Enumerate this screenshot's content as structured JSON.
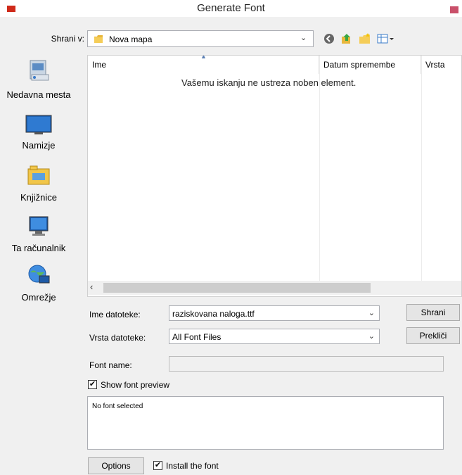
{
  "window": {
    "title": "Generate Font"
  },
  "lookin": {
    "label": "Shrani v:",
    "value": "Nova mapa"
  },
  "places": [
    {
      "label": "Nedavna mesta"
    },
    {
      "label": "Namizje"
    },
    {
      "label": "Knjižnice"
    },
    {
      "label": "Ta računalnik"
    },
    {
      "label": "Omrežje"
    }
  ],
  "filelist": {
    "columns": [
      "Ime",
      "Datum spremembe",
      "Vrsta"
    ],
    "empty_message": "Vašemu iskanju ne ustreza noben element."
  },
  "form": {
    "filename_label": "Ime datoteke:",
    "filename_value": "raziskovana naloga.ttf",
    "filetype_label": "Vrsta datoteke:",
    "filetype_value": "All Font Files",
    "save_label": "Shrani",
    "cancel_label": "Prekliči",
    "fontname_label": "Font name:",
    "fontname_value": "",
    "show_preview_label": "Show font preview",
    "show_preview_checked": true,
    "preview_text": "No font selected",
    "options_label": "Options",
    "install_label": "Install the font",
    "install_checked": true
  }
}
